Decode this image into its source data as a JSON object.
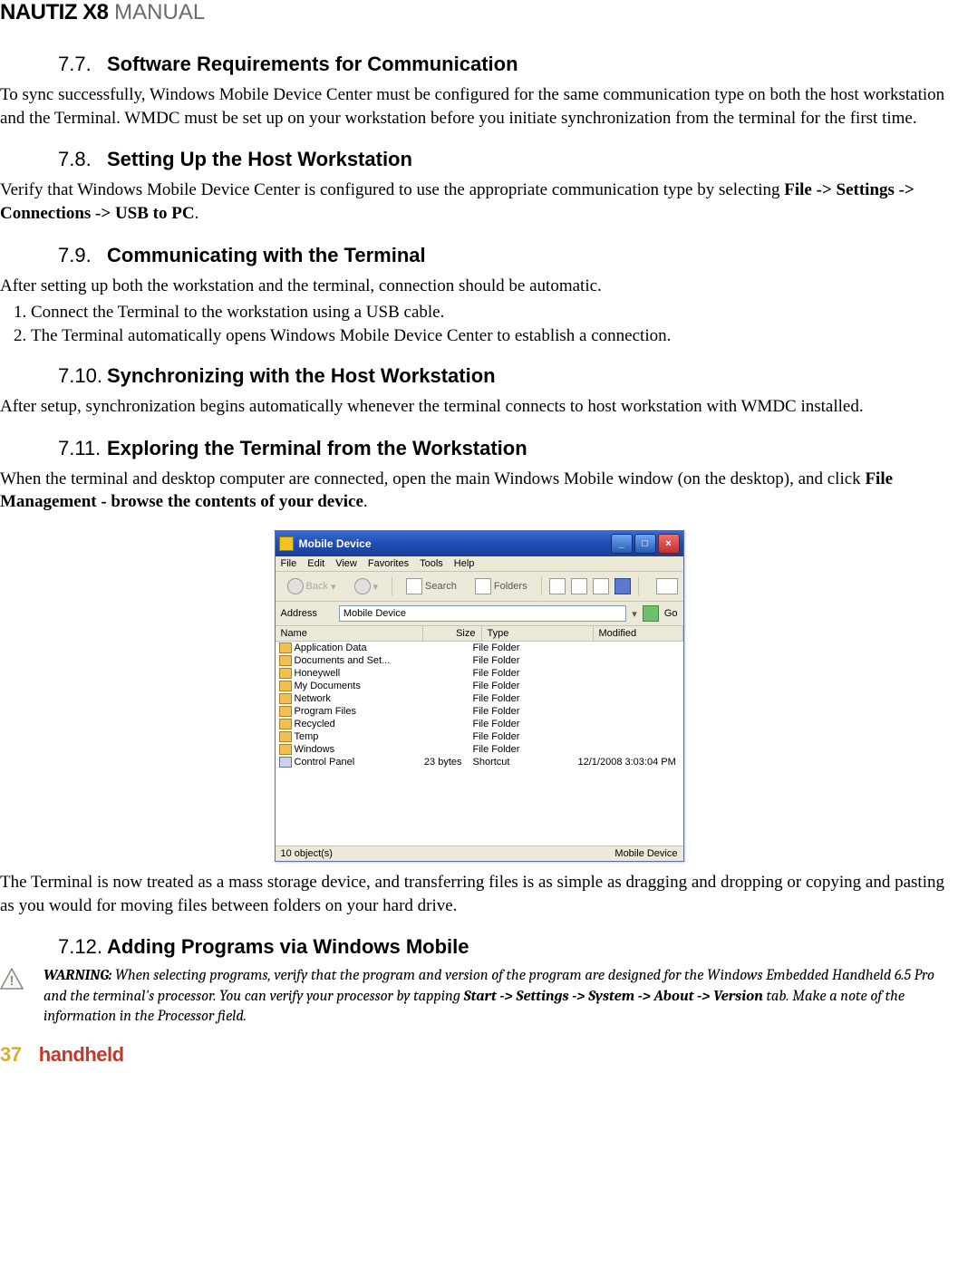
{
  "header": {
    "bold": "NAUTIZ X8",
    "light": " MANUAL"
  },
  "footer": {
    "page": "37",
    "brand": "handheld"
  },
  "s77": {
    "num": "7.7.",
    "title": "Software Requirements for Communication",
    "body": "To sync successfully, Windows Mobile Device Center must be configured for the same communication type on both the host workstation and the Terminal. WMDC must be set up on your workstation before you initiate synchronization from the terminal for the first time."
  },
  "s78": {
    "num": "7.8.",
    "title": "Setting Up the Host Workstation",
    "body_pre": "Verify that Windows Mobile Device Center is configured to use the appropriate communication type by selecting ",
    "body_bold": "File -> Settings -> Connections -> USB to PC",
    "body_post": "."
  },
  "s79": {
    "num": "7.9.",
    "title": "Communicating with the Terminal",
    "body": "After setting up both the workstation and the terminal, connection should be automatic.",
    "li1": "Connect the Terminal to the workstation using a USB cable.",
    "li2": "The Terminal automatically opens Windows Mobile Device Center to establish a connection."
  },
  "s710": {
    "num": "7.10.",
    "title": "Synchronizing with the Host Workstation",
    "body": "After setup, synchronization begins automatically whenever the terminal connects to host workstation with WMDC installed."
  },
  "s711": {
    "num": "7.11.",
    "title": "Exploring the Terminal from the Workstation",
    "body_pre": "When the terminal and desktop computer are connected, open the main Windows Mobile window (on the desktop), and click ",
    "body_bold": "File Management - browse the contents of your device",
    "body_post": ".",
    "body2": "The Terminal is now treated as a mass storage device, and transferring files is as simple as dragging and dropping or copying and pasting as you would for moving files between folders on your hard drive."
  },
  "s712": {
    "num": "7.12.",
    "title": "Adding Programs via Windows Mobile",
    "warn_label": "WARNING:",
    "warn_1": " When selecting programs, verify that the program and version of the program are designed for the Windows Embedded Handheld 6.5 Pro and the terminal's processor. You can verify your processor by tapping ",
    "warn_path": "Start -> Settings -> System -> About -> Version",
    "warn_2": " tab. Make a note of the information in the Processor field."
  },
  "win": {
    "title": "Mobile Device",
    "menu": {
      "file": "File",
      "edit": "Edit",
      "view": "View",
      "fav": "Favorites",
      "tools": "Tools",
      "help": "Help"
    },
    "tb": {
      "back": "Back",
      "search": "Search",
      "folders": "Folders"
    },
    "addr": {
      "label": "Address",
      "value": "Mobile Device",
      "go": "Go"
    },
    "cols": {
      "name": "Name",
      "size": "Size",
      "type": "Type",
      "mod": "Modified"
    },
    "rows": [
      {
        "name": "Application Data",
        "size": "",
        "type": "File Folder",
        "mod": "",
        "icon": "f"
      },
      {
        "name": "Documents and Set...",
        "size": "",
        "type": "File Folder",
        "mod": "",
        "icon": "f"
      },
      {
        "name": "Honeywell",
        "size": "",
        "type": "File Folder",
        "mod": "",
        "icon": "f"
      },
      {
        "name": "My Documents",
        "size": "",
        "type": "File Folder",
        "mod": "",
        "icon": "f"
      },
      {
        "name": "Network",
        "size": "",
        "type": "File Folder",
        "mod": "",
        "icon": "f"
      },
      {
        "name": "Program Files",
        "size": "",
        "type": "File Folder",
        "mod": "",
        "icon": "f"
      },
      {
        "name": "Recycled",
        "size": "",
        "type": "File Folder",
        "mod": "",
        "icon": "f"
      },
      {
        "name": "Temp",
        "size": "",
        "type": "File Folder",
        "mod": "",
        "icon": "f"
      },
      {
        "name": "Windows",
        "size": "",
        "type": "File Folder",
        "mod": "",
        "icon": "f"
      },
      {
        "name": "Control Panel",
        "size": "23 bytes",
        "type": "Shortcut",
        "mod": "12/1/2008  3:03:04 PM",
        "icon": "cp"
      }
    ],
    "status": {
      "left": "10 object(s)",
      "right": "Mobile Device"
    }
  }
}
